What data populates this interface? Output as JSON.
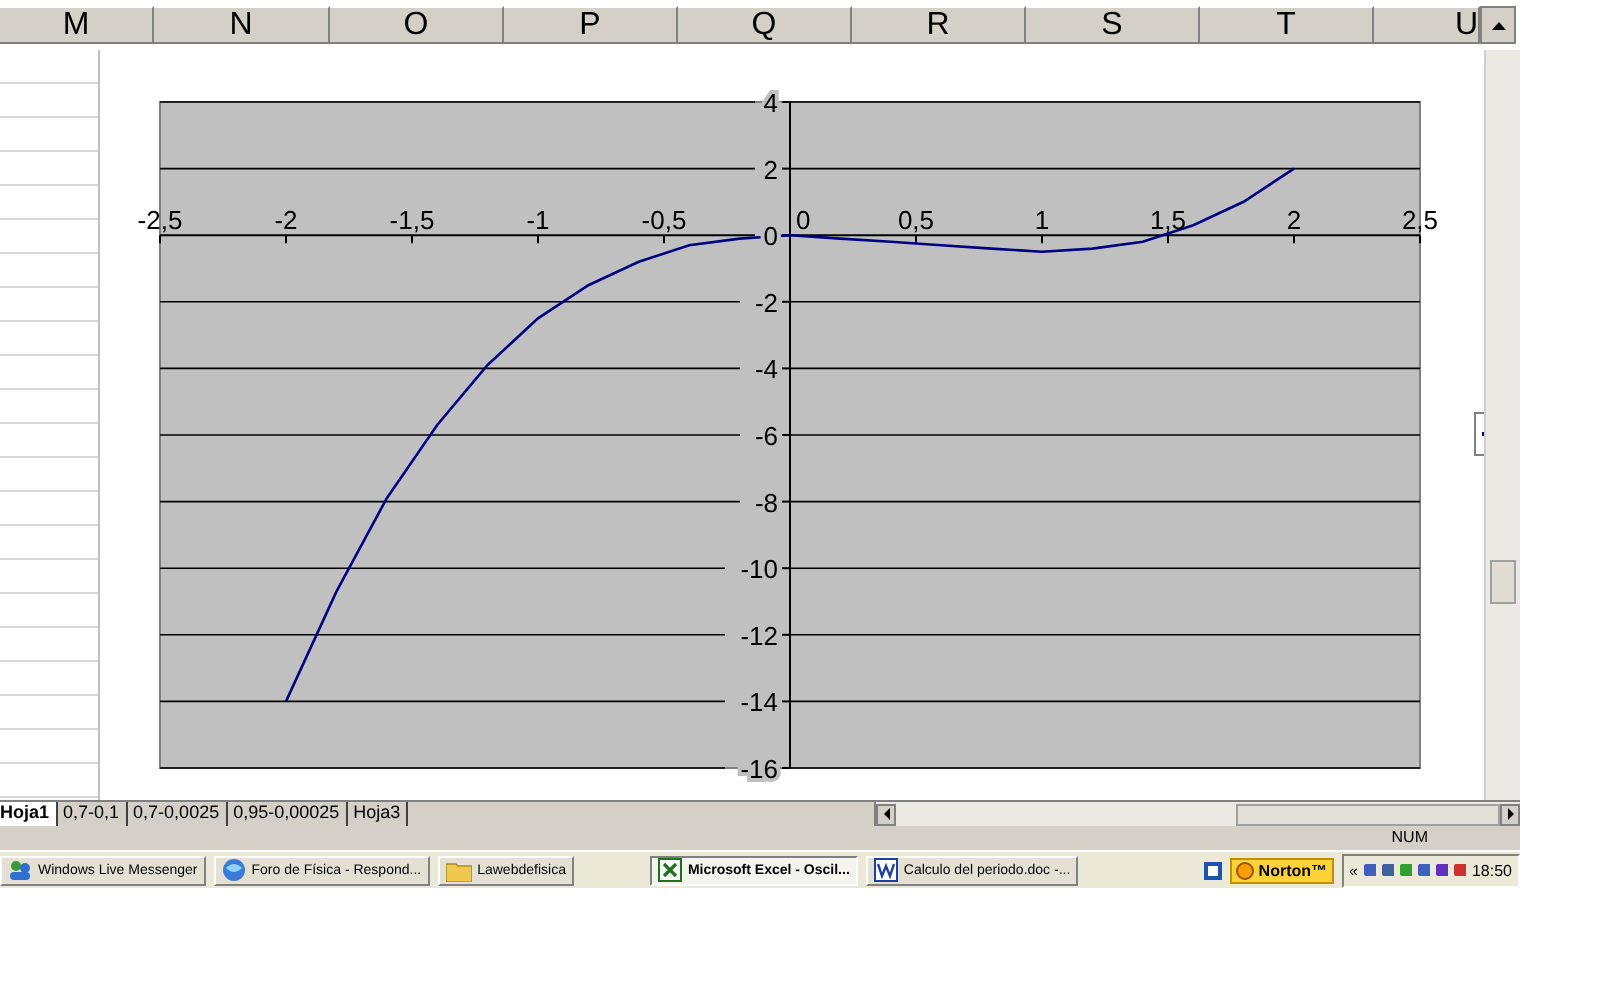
{
  "columns": [
    "M",
    "N",
    "O",
    "P",
    "Q",
    "R",
    "S",
    "T",
    "U"
  ],
  "chart": {
    "chart_data": {
      "type": "line",
      "x": [
        -2,
        -1.8,
        -1.6,
        -1.4,
        -1.2,
        -1,
        -0.8,
        -0.6,
        -0.4,
        -0.2,
        0,
        0.2,
        0.4,
        0.6,
        0.8,
        1,
        1.2,
        1.4,
        1.6,
        1.8,
        2
      ],
      "series": [
        {
          "color": "#000080",
          "values": [
            -14,
            -10.7,
            -7.9,
            -5.7,
            -3.9,
            -2.5,
            -1.5,
            -0.8,
            -0.3,
            -0.1,
            0,
            -0.1,
            -0.2,
            -0.3,
            -0.4,
            -0.5,
            -0.4,
            -0.2,
            0.3,
            1,
            2
          ]
        }
      ],
      "grid": true,
      "xlim": [
        -2.5,
        2.5
      ],
      "ylim": [
        -16,
        4
      ],
      "xticks": [
        {
          "value": -2.5,
          "label": "-2,5"
        },
        {
          "value": -2,
          "label": "-2"
        },
        {
          "value": -1.5,
          "label": "-1,5"
        },
        {
          "value": -1,
          "label": "-1"
        },
        {
          "value": -0.5,
          "label": "-0,5"
        },
        {
          "value": 0,
          "label": "0"
        },
        {
          "value": 0.5,
          "label": "0,5"
        },
        {
          "value": 1,
          "label": "1"
        },
        {
          "value": 1.5,
          "label": "1,5"
        },
        {
          "value": 2,
          "label": "2"
        },
        {
          "value": 2.5,
          "label": "2,5"
        }
      ],
      "yticks": [
        4,
        2,
        0,
        -2,
        -4,
        -6,
        -8,
        -10,
        -12,
        -14,
        -16
      ]
    }
  },
  "sheet_tabs": [
    {
      "label": "Hoja1",
      "selected": true
    },
    {
      "label": "0,7-0,1",
      "selected": false
    },
    {
      "label": "0,7-0,0025",
      "selected": false
    },
    {
      "label": "0,95-0,00025",
      "selected": false
    },
    {
      "label": "Hoja3",
      "selected": false
    }
  ],
  "status_bar": {
    "indicator": "NUM"
  },
  "taskbar": {
    "buttons": [
      {
        "kind": "messenger",
        "label": "Windows Live Messenger",
        "selected": false
      },
      {
        "kind": "browser",
        "label": "Foro de Física - Respond...",
        "selected": false
      },
      {
        "kind": "folder",
        "label": "Lawebdefisica",
        "selected": false
      },
      {
        "kind": "excel",
        "label": "Microsoft Excel - Oscil...",
        "selected": true
      },
      {
        "kind": "word",
        "label": "Calculo del periodo.doc -...",
        "selected": false
      }
    ],
    "tray": {
      "norton": "Norton™",
      "chevron": "«",
      "clock": "18:50"
    }
  }
}
